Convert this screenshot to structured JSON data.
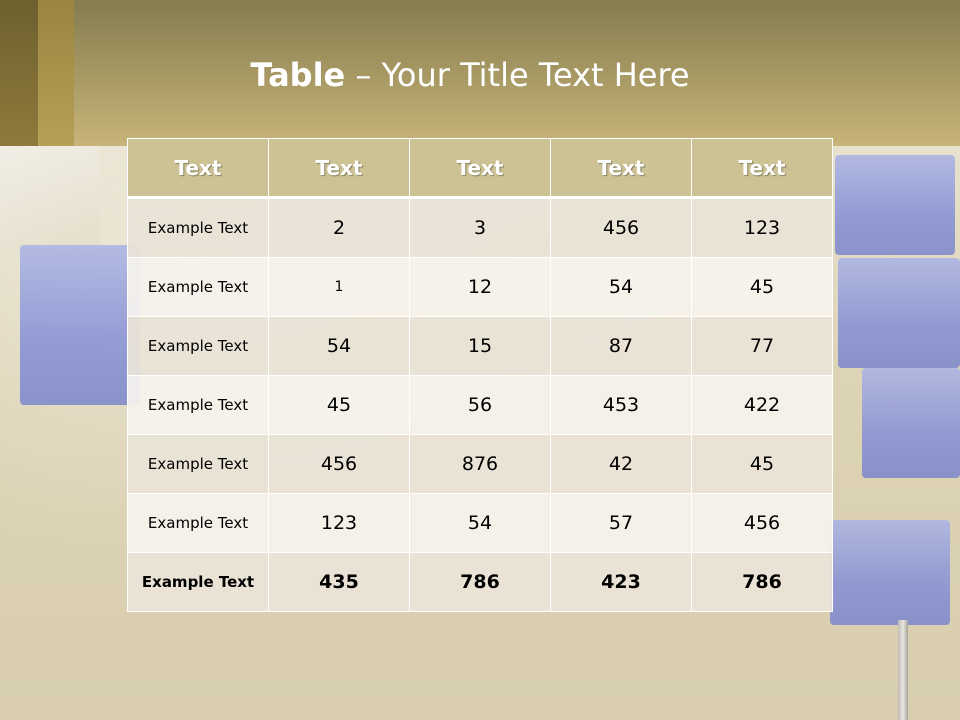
{
  "title": {
    "bold_part": "Table",
    "rest": " – Your Title Text Here"
  },
  "table": {
    "headers": [
      "Text",
      "Text",
      "Text",
      "Text",
      "Text"
    ],
    "rows": [
      [
        "Example Text",
        "2",
        "3",
        "456",
        "123"
      ],
      [
        "Example Text",
        "1",
        "12",
        "54",
        "45"
      ],
      [
        "Example Text",
        "54",
        "15",
        "87",
        "77"
      ],
      [
        "Example Text",
        "45",
        "56",
        "453",
        "422"
      ],
      [
        "Example Text",
        "456",
        "876",
        "42",
        "45"
      ],
      [
        "Example Text",
        "123",
        "54",
        "57",
        "456"
      ],
      [
        "Example Text",
        "435",
        "786",
        "423",
        "786"
      ]
    ]
  },
  "colors": {
    "header_band": "#a39561",
    "table_header": "#cdc293",
    "row_odd": "#e9e3d7",
    "row_even": "#f6f3ed",
    "crates": "#8590d6"
  }
}
